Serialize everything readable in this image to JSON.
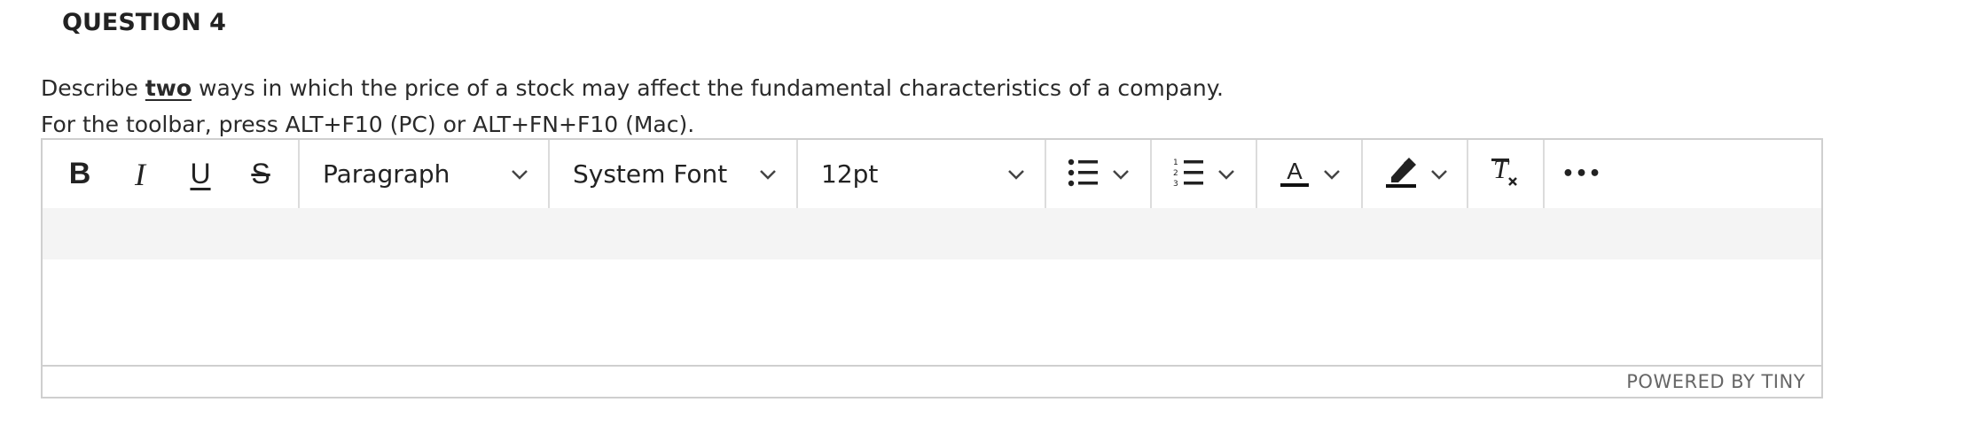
{
  "question": {
    "title": "QUESTION 4",
    "prompt_before": "Describe ",
    "prompt_emphasis": "two",
    "prompt_after": " ways in which the price of a stock may affect the fundamental characteristics of a company.",
    "toolbar_hint": "For the toolbar, press ALT+F10 (PC) or ALT+FN+F10 (Mac)."
  },
  "toolbar": {
    "bold_label": "B",
    "italic_label": "I",
    "underline_label": "U",
    "strike_label": "S",
    "block_format_value": "Paragraph",
    "font_family_value": "System Font",
    "font_size_value": "12pt",
    "more_label": "•••",
    "icons": {
      "bullet_list": "bullet-list-icon",
      "numbered_list": "numbered-list-icon",
      "text_color": "text-color-icon",
      "highlight": "highlight-icon",
      "clear_format": "clear-formatting-icon",
      "more": "more-icon"
    }
  },
  "editor": {
    "content": ""
  },
  "statusbar": {
    "branding": "POWERED BY TINY"
  }
}
